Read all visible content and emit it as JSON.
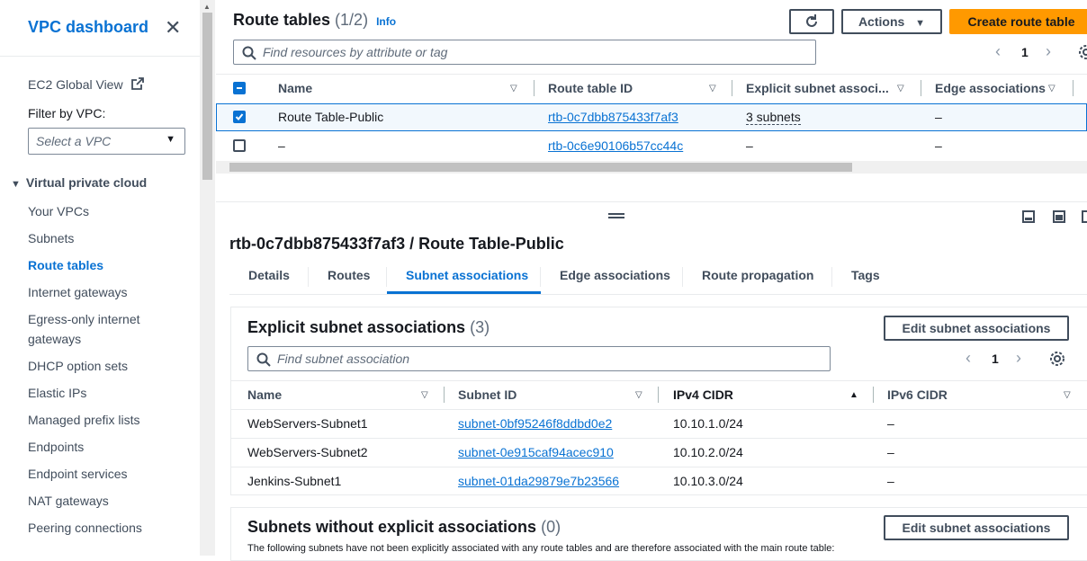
{
  "sidebar": {
    "title": "VPC dashboard",
    "close_icon": "close-icon",
    "global_view": "EC2 Global View",
    "filter_label": "Filter by VPC:",
    "filter_placeholder": "Select a VPC",
    "section": "Virtual private cloud",
    "items": [
      {
        "label": "Your VPCs",
        "active": false
      },
      {
        "label": "Subnets",
        "active": false
      },
      {
        "label": "Route tables",
        "active": true
      },
      {
        "label": "Internet gateways",
        "active": false
      },
      {
        "label": "Egress-only internet",
        "active": false
      },
      {
        "label": "gateways",
        "active": false
      },
      {
        "label": "DHCP option sets",
        "active": false
      },
      {
        "label": "Elastic IPs",
        "active": false
      },
      {
        "label": "Managed prefix lists",
        "active": false
      },
      {
        "label": "Endpoints",
        "active": false
      },
      {
        "label": "Endpoint services",
        "active": false
      },
      {
        "label": "NAT gateways",
        "active": false
      },
      {
        "label": "Peering connections",
        "active": false
      }
    ]
  },
  "header": {
    "title": "Route tables",
    "count": "(1/2)",
    "info": "Info",
    "actions_label": "Actions",
    "create_label": "Create route table",
    "search_placeholder": "Find resources by attribute or tag",
    "page": "1"
  },
  "table": {
    "columns": [
      "Name",
      "Route table ID",
      "Explicit subnet associ...",
      "Edge associations"
    ],
    "rows": [
      {
        "selected": true,
        "name": "Route Table-Public",
        "id": "rtb-0c7dbb875433f7af3",
        "explicit": "3 subnets",
        "edge": "–"
      },
      {
        "selected": false,
        "name": "–",
        "id": "rtb-0c6e90106b57cc44c",
        "explicit": "–",
        "edge": "–"
      }
    ]
  },
  "detail": {
    "title": "rtb-0c7dbb875433f7af3 / Route Table-Public",
    "tabs": [
      "Details",
      "Routes",
      "Subnet associations",
      "Edge associations",
      "Route propagation",
      "Tags"
    ],
    "active_tab": "Subnet associations"
  },
  "explicit": {
    "title": "Explicit subnet associations",
    "count": "(3)",
    "edit_label": "Edit subnet associations",
    "search_placeholder": "Find subnet association",
    "page": "1",
    "columns": [
      "Name",
      "Subnet ID",
      "IPv4 CIDR",
      "IPv6 CIDR"
    ],
    "rows": [
      {
        "name": "WebServers-Subnet1",
        "id": "subnet-0bf95246f8ddbd0e2",
        "ipv4": "10.10.1.0/24",
        "ipv6": "–"
      },
      {
        "name": "WebServers-Subnet2",
        "id": "subnet-0e915caf94acec910",
        "ipv4": "10.10.2.0/24",
        "ipv6": "–"
      },
      {
        "name": "Jenkins-Subnet1",
        "id": "subnet-01da29879e7b23566",
        "ipv4": "10.10.3.0/24",
        "ipv6": "–"
      }
    ]
  },
  "without": {
    "title": "Subnets without explicit associations",
    "count": "(0)",
    "edit_label": "Edit subnet associations",
    "description": "The following subnets have not been explicitly associated with any route tables and are therefore associated with the main route table:"
  },
  "colors": {
    "accent": "#0972d3",
    "primary_button": "#ff9900"
  }
}
